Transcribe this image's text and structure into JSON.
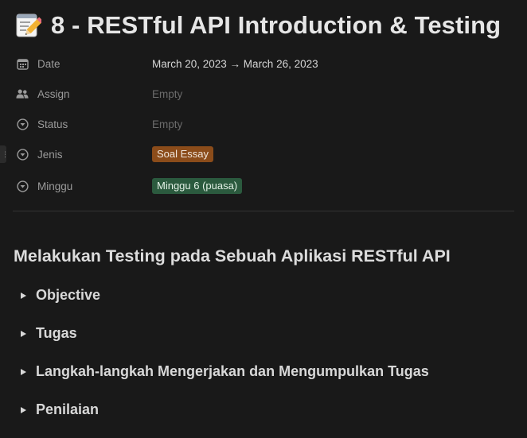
{
  "page": {
    "icon": "memo-pencil-icon",
    "title": "8 - RESTful API Introduction & Testing"
  },
  "properties": [
    {
      "icon": "calendar-icon",
      "name": "Date",
      "value": "March 20, 2023 → March 26, 2023",
      "type": "text"
    },
    {
      "icon": "people-icon",
      "name": "Assign",
      "value": "Empty",
      "type": "empty"
    },
    {
      "icon": "select-circle-icon",
      "name": "Status",
      "value": "Empty",
      "type": "empty"
    },
    {
      "icon": "select-circle-icon",
      "name": "Jenis",
      "value": "Soal Essay",
      "type": "tag",
      "tag_color": "#8b4c1a"
    },
    {
      "icon": "select-circle-icon",
      "name": "Minggu",
      "value": "Minggu 6 (puasa)",
      "type": "tag",
      "tag_color": "#2b5a3e"
    }
  ],
  "content": {
    "heading": "Melakukan Testing pada Sebuah Aplikasi RESTful API",
    "toggles": [
      {
        "label": "Objective"
      },
      {
        "label": "Tugas"
      },
      {
        "label": "Langkah-langkah Mengerjakan dan Mengumpulkan Tugas"
      },
      {
        "label": "Penilaian"
      }
    ]
  },
  "sidebar_handle": {
    "icon": "drag-handle-icon"
  }
}
